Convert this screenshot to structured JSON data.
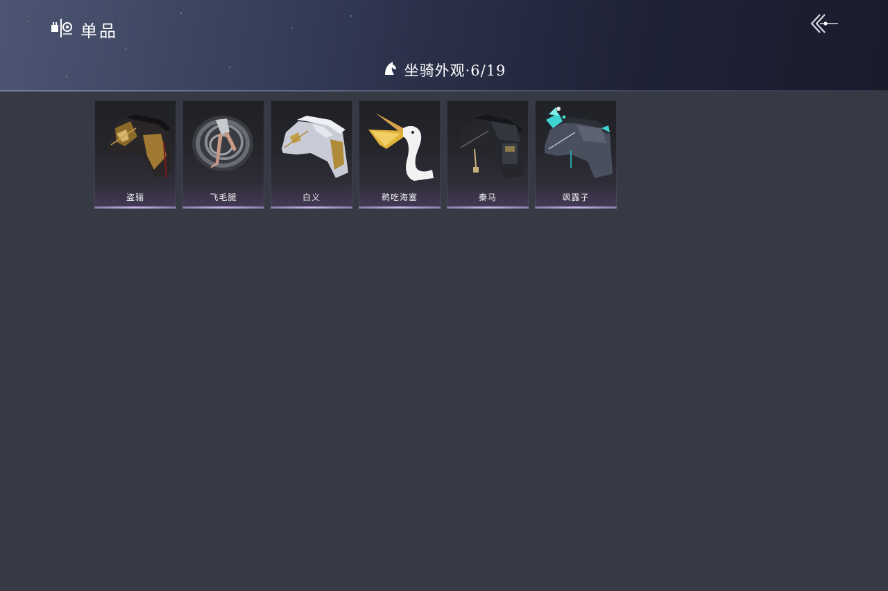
{
  "header": {
    "title": "单品",
    "back_icon": "back-arrow-icon",
    "brand_icon": "wardrobe-icon"
  },
  "collection": {
    "icon": "horse-head-icon",
    "title": "坐骑外观·6/19"
  },
  "items": [
    {
      "name": "盗骊",
      "art": "armored-dark-horse-icon"
    },
    {
      "name": "飞毛腿",
      "art": "spinning-legs-icon"
    },
    {
      "name": "白义",
      "art": "white-horse-icon"
    },
    {
      "name": "鹈吃海塞",
      "art": "pelican-icon"
    },
    {
      "name": "秦马",
      "art": "black-armored-horse-icon"
    },
    {
      "name": "飒露子",
      "art": "teal-ornament-horse-icon"
    }
  ],
  "colors": {
    "background": "#363a44",
    "card_accent": "#c9b6e6",
    "ornament_teal": "#3fd4d0"
  }
}
